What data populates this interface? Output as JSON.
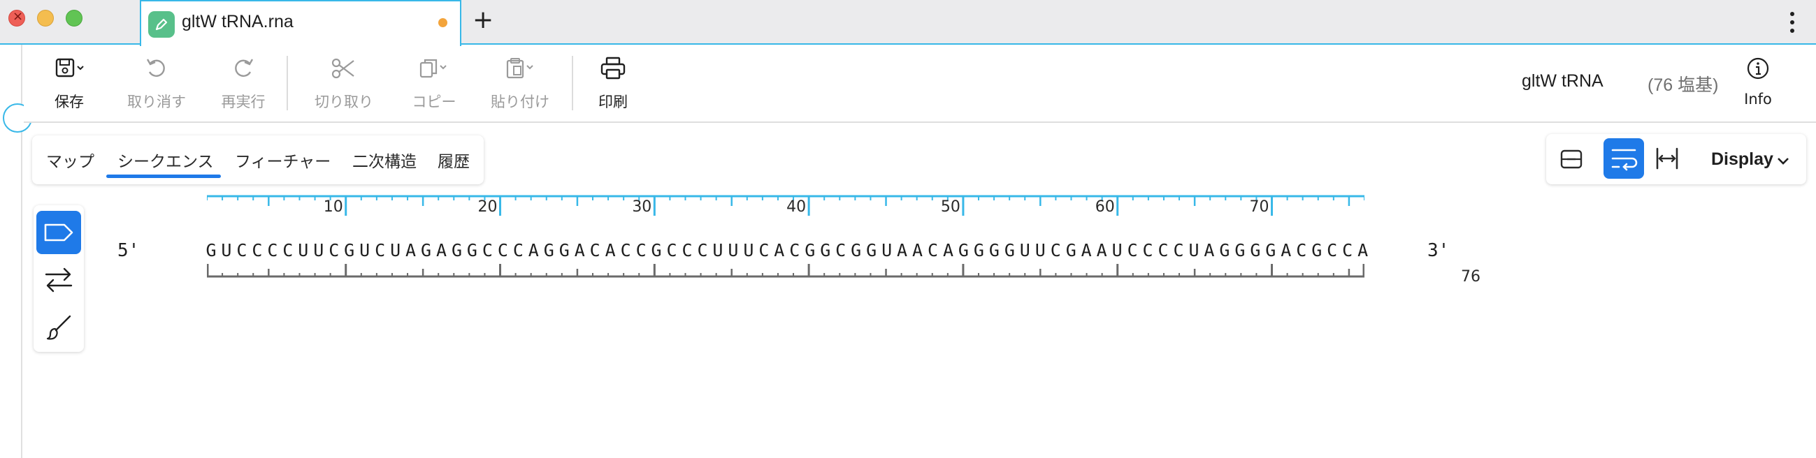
{
  "window": {
    "tab_title": "gltW tRNA.rna",
    "new_tab": "+",
    "tab_menu": "⋮"
  },
  "toolbar": {
    "save": "保存",
    "undo": "取り消す",
    "redo": "再実行",
    "cut": "切り取り",
    "copy": "コピー",
    "paste": "貼り付け",
    "print": "印刷",
    "info": "Info",
    "doc_name": "gltW tRNA",
    "doc_length": "(76 塩基)"
  },
  "view_tabs": [
    {
      "label": "マップ",
      "selected": false
    },
    {
      "label": "シークエンス",
      "selected": true
    },
    {
      "label": "フィーチャー",
      "selected": false
    },
    {
      "label": "二次構造",
      "selected": false
    },
    {
      "label": "履歴",
      "selected": false
    }
  ],
  "display_controls": {
    "display_label": "Display",
    "wrap_selected": true
  },
  "palette": {
    "selected_tool": "feature-tag"
  },
  "sequence": {
    "prime5": "5'",
    "prime3": "3'",
    "bases": "GUCCCCUUCGUCUAGAGGCCCAGGACACCGCCCUUUCACGGCGGUAACAGGGGUUCGAAUCCCCUAGGGGACGCCA",
    "length": 76,
    "end_label": "76",
    "tick_labels": [
      "10",
      "20",
      "30",
      "40",
      "50",
      "60",
      "70"
    ]
  },
  "colors": {
    "accent": "#1f7ae8",
    "ruler_top": "#38b8e8",
    "ruler_bottom": "#6a6a6a",
    "modified_dot": "#f3a43b"
  }
}
